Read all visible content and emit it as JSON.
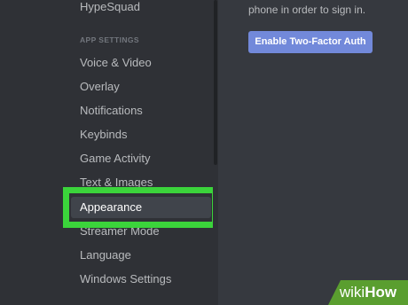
{
  "sidebar": {
    "top_item": "HypeSquad",
    "section_header": "APP SETTINGS",
    "items": [
      {
        "label": "Voice & Video"
      },
      {
        "label": "Overlay"
      },
      {
        "label": "Notifications"
      },
      {
        "label": "Keybinds"
      },
      {
        "label": "Game Activity"
      },
      {
        "label": "Text & Images"
      },
      {
        "label": "Appearance",
        "selected": true
      },
      {
        "label": "Streamer Mode"
      },
      {
        "label": "Language"
      },
      {
        "label": "Windows Settings"
      }
    ]
  },
  "main": {
    "text_fragment": "phone in order to sign in.",
    "enable_2fa_label": "Enable Two-Factor Auth"
  },
  "watermark": {
    "prefix": "wiki",
    "suffix": "How"
  },
  "colors": {
    "sidebar_bg": "#2f3136",
    "main_bg": "#36393f",
    "accent": "#7289da",
    "highlight": "#3bd43b"
  }
}
